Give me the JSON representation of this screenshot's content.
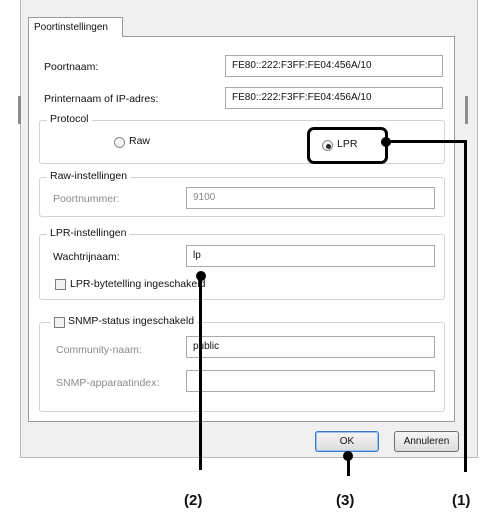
{
  "tab": {
    "label": "Poortinstellingen"
  },
  "port_name": {
    "label": "Poortnaam:",
    "value": "FE80::222:F3FF:FE04:456A/10"
  },
  "printer_address": {
    "label": "Printernaam of IP-adres:",
    "value": "FE80::222:F3FF:FE04:456A/10"
  },
  "protocol": {
    "legend": "Protocol",
    "options": [
      {
        "label": "Raw",
        "selected": false
      },
      {
        "label": "LPR",
        "selected": true
      }
    ]
  },
  "raw_settings": {
    "legend": "Raw-instellingen",
    "port_number_label": "Poortnummer:",
    "port_number_value": "9100"
  },
  "lpr_settings": {
    "legend": "LPR-instellingen",
    "queue_name_label": "Wachtrijnaam:",
    "queue_name_value": "lp",
    "byte_counting_label": "LPR-bytetelling ingeschakeld",
    "byte_counting_checked": false
  },
  "snmp": {
    "checkbox_label": "SNMP-status ingeschakeld",
    "checked": false,
    "community_label": "Community-naam:",
    "community_value": "public",
    "device_index_label": "SNMP-apparaatindex:",
    "device_index_value": ""
  },
  "buttons": {
    "ok": "OK",
    "cancel": "Annuleren"
  },
  "callouts": {
    "c1": "(1)",
    "c2": "(2)",
    "c3": "(3)"
  },
  "colors": {
    "dialog_bg": "#f0f0f0",
    "panel_bg": "#ffffff",
    "annotation": "#000000"
  }
}
